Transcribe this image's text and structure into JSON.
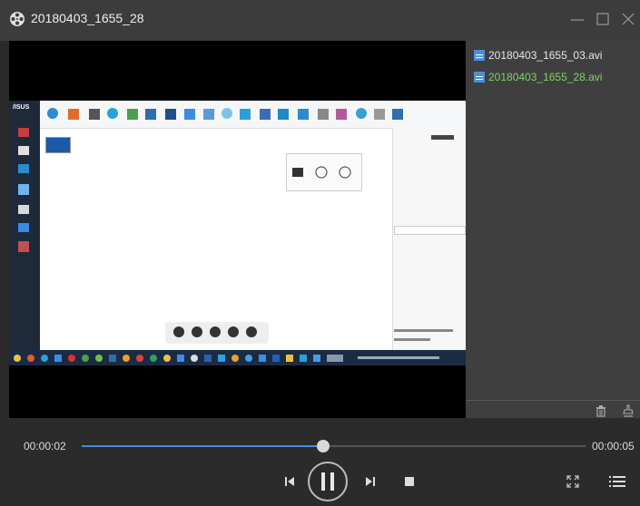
{
  "window": {
    "title": "20180403_1655_28"
  },
  "playlist": {
    "items": [
      {
        "label": "20180403_1655_03.avi",
        "color": "#e8e8e8"
      },
      {
        "label": "20180403_1655_28.avi",
        "color": "#7fd36a"
      }
    ]
  },
  "player": {
    "current_time": "00:00:02",
    "total_time": "00:00:05",
    "progress": 0.48,
    "accent": "#3a8ee6",
    "icons": [
      "prev-icon",
      "pause-icon",
      "next-icon",
      "stop-icon",
      "fullscreen-icon",
      "playlist-icon"
    ]
  },
  "video_frame": {
    "brand": "/ISUS"
  }
}
